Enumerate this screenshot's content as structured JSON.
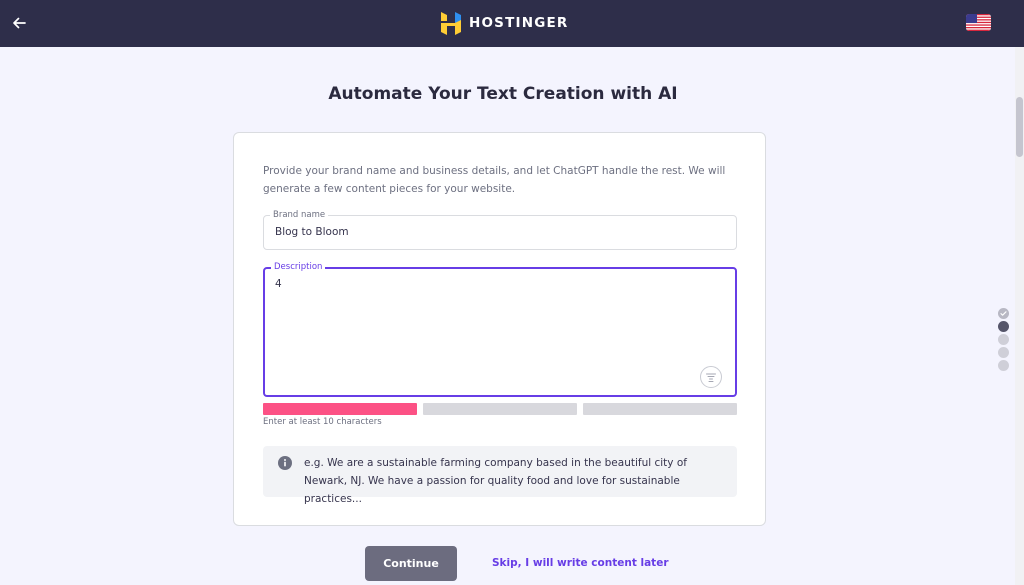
{
  "header": {
    "brand": "HOSTINGER",
    "back_icon": "arrow-left-icon",
    "language_icon": "us-flag-icon",
    "background": "#2e2e4a"
  },
  "page": {
    "title": "Automate Your Text Creation with AI",
    "intro": "Provide your brand name and business details, and let ChatGPT handle the rest. We will generate a few content pieces for your website."
  },
  "form": {
    "brand_name": {
      "label": "Brand name",
      "value": "Blog to Bloom"
    },
    "description": {
      "label": "Description",
      "value": "4",
      "ai_icon": "ai-suggest-icon"
    },
    "strength": {
      "filled_segments": 1,
      "total_segments": 3,
      "active_color": "#fc5185",
      "inactive_color": "#d8d8dd"
    },
    "hint": "Enter at least 10 characters",
    "example": "e.g. We are a sustainable farming company based in the beautiful city of Newark, NJ. We have a passion for quality food and love for sustainable practices..."
  },
  "actions": {
    "continue_label": "Continue",
    "skip_label": "Skip, I will write content later"
  },
  "progress": {
    "steps": [
      {
        "state": "completed"
      },
      {
        "state": "current"
      },
      {
        "state": "upcoming"
      },
      {
        "state": "upcoming"
      },
      {
        "state": "upcoming"
      }
    ]
  },
  "colors": {
    "accent": "#673de6",
    "page_bg": "#f4f4fe"
  }
}
